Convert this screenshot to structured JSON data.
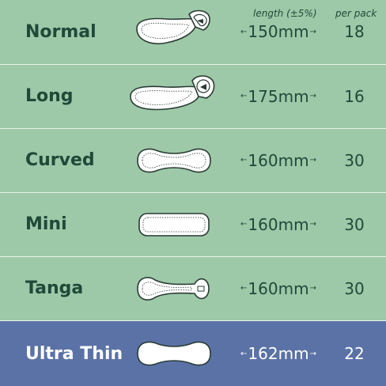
{
  "headers": {
    "length": "length (±5%)",
    "per_pack": "per pack"
  },
  "rows": [
    {
      "name": "Normal",
      "length": "150mm",
      "count": "18",
      "icon": "normal-pad-icon"
    },
    {
      "name": "Long",
      "length": "175mm",
      "count": "16",
      "icon": "long-pad-icon"
    },
    {
      "name": "Curved",
      "length": "160mm",
      "count": "30",
      "icon": "curved-pad-icon"
    },
    {
      "name": "Mini",
      "length": "160mm",
      "count": "30",
      "icon": "mini-pad-icon"
    },
    {
      "name": "Tanga",
      "length": "160mm",
      "count": "30",
      "icon": "tanga-pad-icon"
    },
    {
      "name": "Ultra Thin",
      "length": "162mm",
      "count": "22",
      "icon": "ultra-thin-pad-icon"
    }
  ],
  "arrows": {
    "left": "←",
    "right": "→"
  },
  "colors": {
    "green_bg": "#9dc9a8",
    "blue_bg": "#5b72a6",
    "dark_text": "#1f4a3a",
    "white_text": "#ffffff"
  }
}
